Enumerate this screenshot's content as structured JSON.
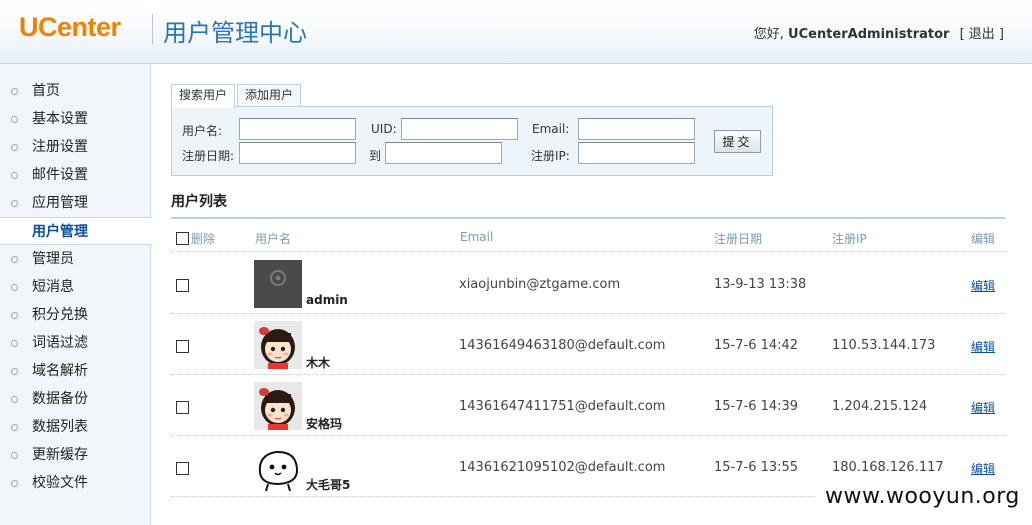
{
  "header": {
    "logo": "UCenter",
    "title": "用户管理中心",
    "greeting": "您好,",
    "username": "UCenterAdministrator",
    "logout": "[ 退出 ]"
  },
  "sidebar": {
    "items": [
      {
        "label": "首页"
      },
      {
        "label": "基本设置"
      },
      {
        "label": "注册设置"
      },
      {
        "label": "邮件设置"
      },
      {
        "label": "应用管理"
      },
      {
        "label": "用户管理",
        "active": true
      },
      {
        "label": "管理员"
      },
      {
        "label": "短消息"
      },
      {
        "label": "积分兑换"
      },
      {
        "label": "词语过滤"
      },
      {
        "label": "域名解析"
      },
      {
        "label": "数据备份"
      },
      {
        "label": "数据列表"
      },
      {
        "label": "更新缓存"
      },
      {
        "label": "校验文件"
      }
    ]
  },
  "tabs": [
    {
      "label": "搜索用户",
      "active": true
    },
    {
      "label": "添加用户"
    }
  ],
  "search": {
    "username_label": "用户名:",
    "uid_label": "UID:",
    "email_label": "Email:",
    "regdate_label": "注册日期:",
    "to_label": "到",
    "regip_label": "注册IP:",
    "username_value": "",
    "uid_value": "",
    "email_value": "",
    "regdate_from": "",
    "regdate_to": "",
    "regip_value": "",
    "submit": "提交"
  },
  "list": {
    "title": "用户列表",
    "columns": {
      "delete": "删除",
      "username": "用户名",
      "email": "Email",
      "regdate": "注册日期",
      "regip": "注册IP",
      "edit": "编辑"
    },
    "rows": [
      {
        "username": "admin",
        "email": "xiaojunbin@ztgame.com",
        "regdate": "13-9-13 13:38",
        "regip": "",
        "edit": "编辑",
        "avatar": "chrome-placeholder-icon"
      },
      {
        "username": "木木",
        "email": "14361649463180@default.com",
        "regdate": "15-7-6 14:42",
        "regip": "110.53.144.173",
        "edit": "编辑",
        "avatar": "cartoon-girl-avatar"
      },
      {
        "username": "安格玛",
        "email": "14361647411751@default.com",
        "regdate": "15-7-6 14:39",
        "regip": "1.204.215.124",
        "edit": "编辑",
        "avatar": "cartoon-girl-avatar"
      },
      {
        "username": "大毛哥5",
        "email": "14361621095102@default.com",
        "regdate": "15-7-6 13:55",
        "regip": "180.168.126.117",
        "edit": "编辑",
        "avatar": "white-blob-avatar"
      }
    ]
  },
  "watermark": "www.wooyun.org",
  "colors": {
    "logo": "#f08200",
    "title": "#2a75b6",
    "link": "#0b4f9c",
    "column_header": "#7a9ab8"
  }
}
